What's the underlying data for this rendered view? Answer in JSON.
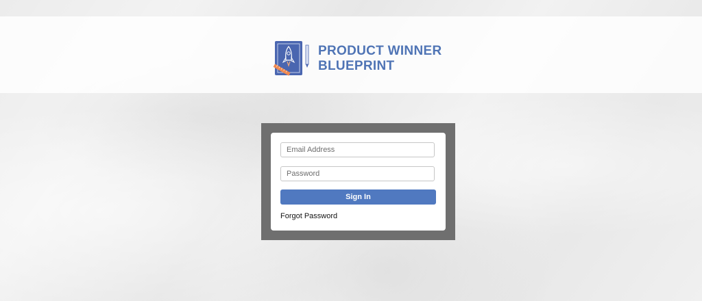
{
  "brand": {
    "logo_line1": "PRODUCT WINNER",
    "logo_line2": "BLUEPRINT",
    "logo_icon": "rocket-blueprint-icon",
    "text_color": "#4f74b5"
  },
  "login": {
    "email_placeholder": "Email Address",
    "email_value": "",
    "password_placeholder": "Password",
    "password_value": "",
    "sign_in_label": "Sign In",
    "forgot_label": "Forgot Password",
    "button_color": "#5079c0",
    "frame_color": "#6f6f6f"
  }
}
